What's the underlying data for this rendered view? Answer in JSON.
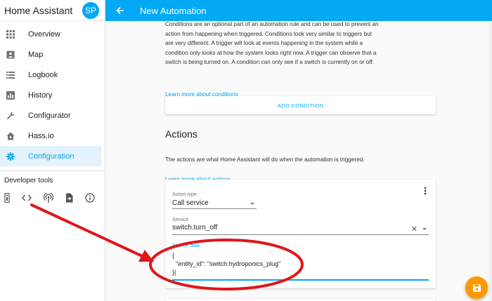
{
  "sidebar": {
    "title": "Home Assistant",
    "avatar_initials": "SP",
    "items": [
      {
        "label": "Overview",
        "icon": "grid-icon"
      },
      {
        "label": "Map",
        "icon": "map-person-icon"
      },
      {
        "label": "Logbook",
        "icon": "list-icon"
      },
      {
        "label": "History",
        "icon": "bar-chart-icon"
      },
      {
        "label": "Configurator",
        "icon": "wrench-icon"
      },
      {
        "label": "Hass.io",
        "icon": "home-icon"
      },
      {
        "label": "Configuration",
        "icon": "gear-icon",
        "active": true
      }
    ],
    "developer_tools_title": "Developer tools",
    "developer_tools_icons": [
      "remote-icon",
      "code-icon",
      "broadcast-icon",
      "file-export-icon",
      "info-icon"
    ]
  },
  "topbar": {
    "title": "New Automation",
    "color": "#03a9f4"
  },
  "conditions": {
    "description": "Conditions are an optional part of an automation rule and can be used to prevent an action from happening when triggered. Conditions look very similar to triggers but are very different. A trigger will look at events happening in the system while a condition only looks at how the system looks right now. A trigger can observe that a switch is being turned on. A condition can only see if a switch is currently on or off.",
    "learn_more": "Learn more about conditions",
    "add_button": "ADD CONDITION"
  },
  "actions": {
    "heading": "Actions",
    "description": "The actions are what Home Assistant will do when the automation is triggered.",
    "learn_more": "Learn more about actions",
    "action_type_label": "Action type",
    "action_type_value": "Call service",
    "service_label": "Service",
    "service_value": "switch.turn_off",
    "clear_symbol": "✕",
    "service_data_label": "Service data",
    "service_data_value": "{\n  \"entity_id\": \"switch.hydroponics_plug\"\n}|"
  },
  "fab": {
    "icon": "save-icon",
    "color": "#ff9800"
  },
  "annotation": {
    "color": "#e0161b"
  }
}
